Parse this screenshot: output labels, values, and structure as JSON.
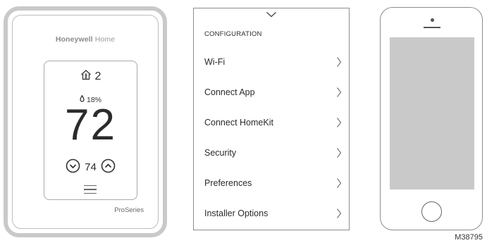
{
  "thermostat": {
    "brand_bold": "Honeywell",
    "brand_rest": " Home",
    "occupancy_count": "2",
    "humidity": "18%",
    "temperature": "72",
    "setpoint": "74",
    "series_prefix": "Pro",
    "series_rest": "Series",
    "icons": [
      "home-occupancy-icon",
      "humidity-drop-icon",
      "chevron-down-circle-icon",
      "chevron-up-circle-icon",
      "menu-icon"
    ]
  },
  "menu": {
    "collapse_icon": "chevron-down-icon",
    "section_title": "CONFIGURATION",
    "items": [
      {
        "label": "Wi-Fi"
      },
      {
        "label": "Connect App"
      },
      {
        "label": "Connect HomeKit"
      },
      {
        "label": "Security"
      },
      {
        "label": "Preferences"
      },
      {
        "label": "Installer Options"
      }
    ]
  },
  "phone": {
    "screen_color": "#c9c9c9"
  },
  "figure_id": "M38795"
}
